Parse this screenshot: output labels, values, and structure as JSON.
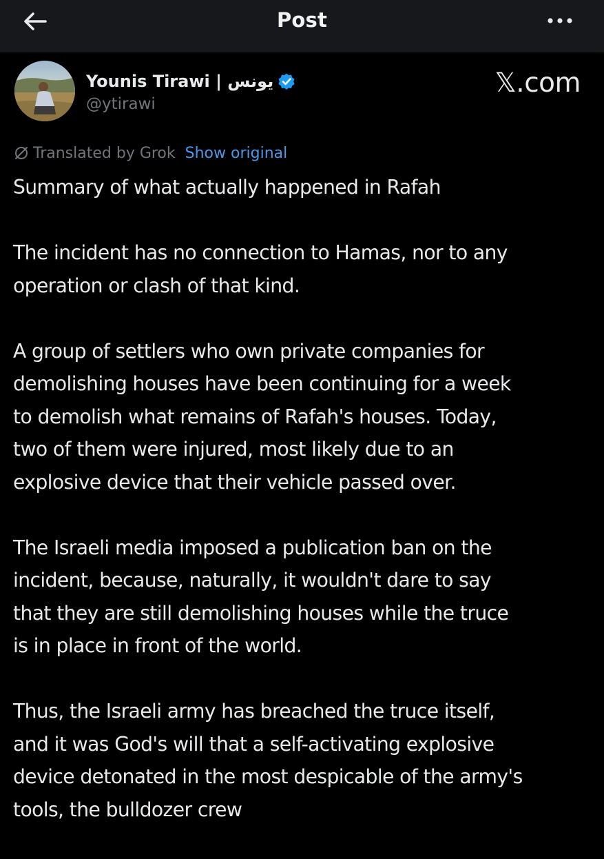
{
  "header": {
    "title": "Post",
    "back_icon": "arrow-left-icon",
    "more_icon": "more-horizontal-icon"
  },
  "author": {
    "name": "Younis Tirawi | يونس",
    "handle": "@ytirawi",
    "verified": true,
    "verified_color": "#1d9bf0"
  },
  "watermark": "𝕏.com",
  "translation": {
    "label": "Translated by Grok",
    "action": "Show original",
    "icon": "grok-icon",
    "action_color": "#4a99e9"
  },
  "post": {
    "paragraphs": [
      "Summary of what actually happened in Rafah",
      "The incident has no connection to Hamas, nor to any\noperation or clash of that kind.",
      "A group of settlers who own private companies for\ndemolishing houses have been continuing for a week\nto demolish what remains of Rafah's houses. Today,\ntwo of them were injured, most likely due to an\nexplosive device that their vehicle passed over.",
      "The Israeli media imposed a publication ban on the\nincident, because, naturally, it wouldn't dare to say\nthat they are still demolishing houses while the truce\nis in place in front of the world.",
      "Thus, the Israeli army has breached the truce itself,\nand it was God's will that a self-activating explosive\ndevice detonated in the most despicable of the army's\ntools, the bulldozer crew"
    ]
  }
}
